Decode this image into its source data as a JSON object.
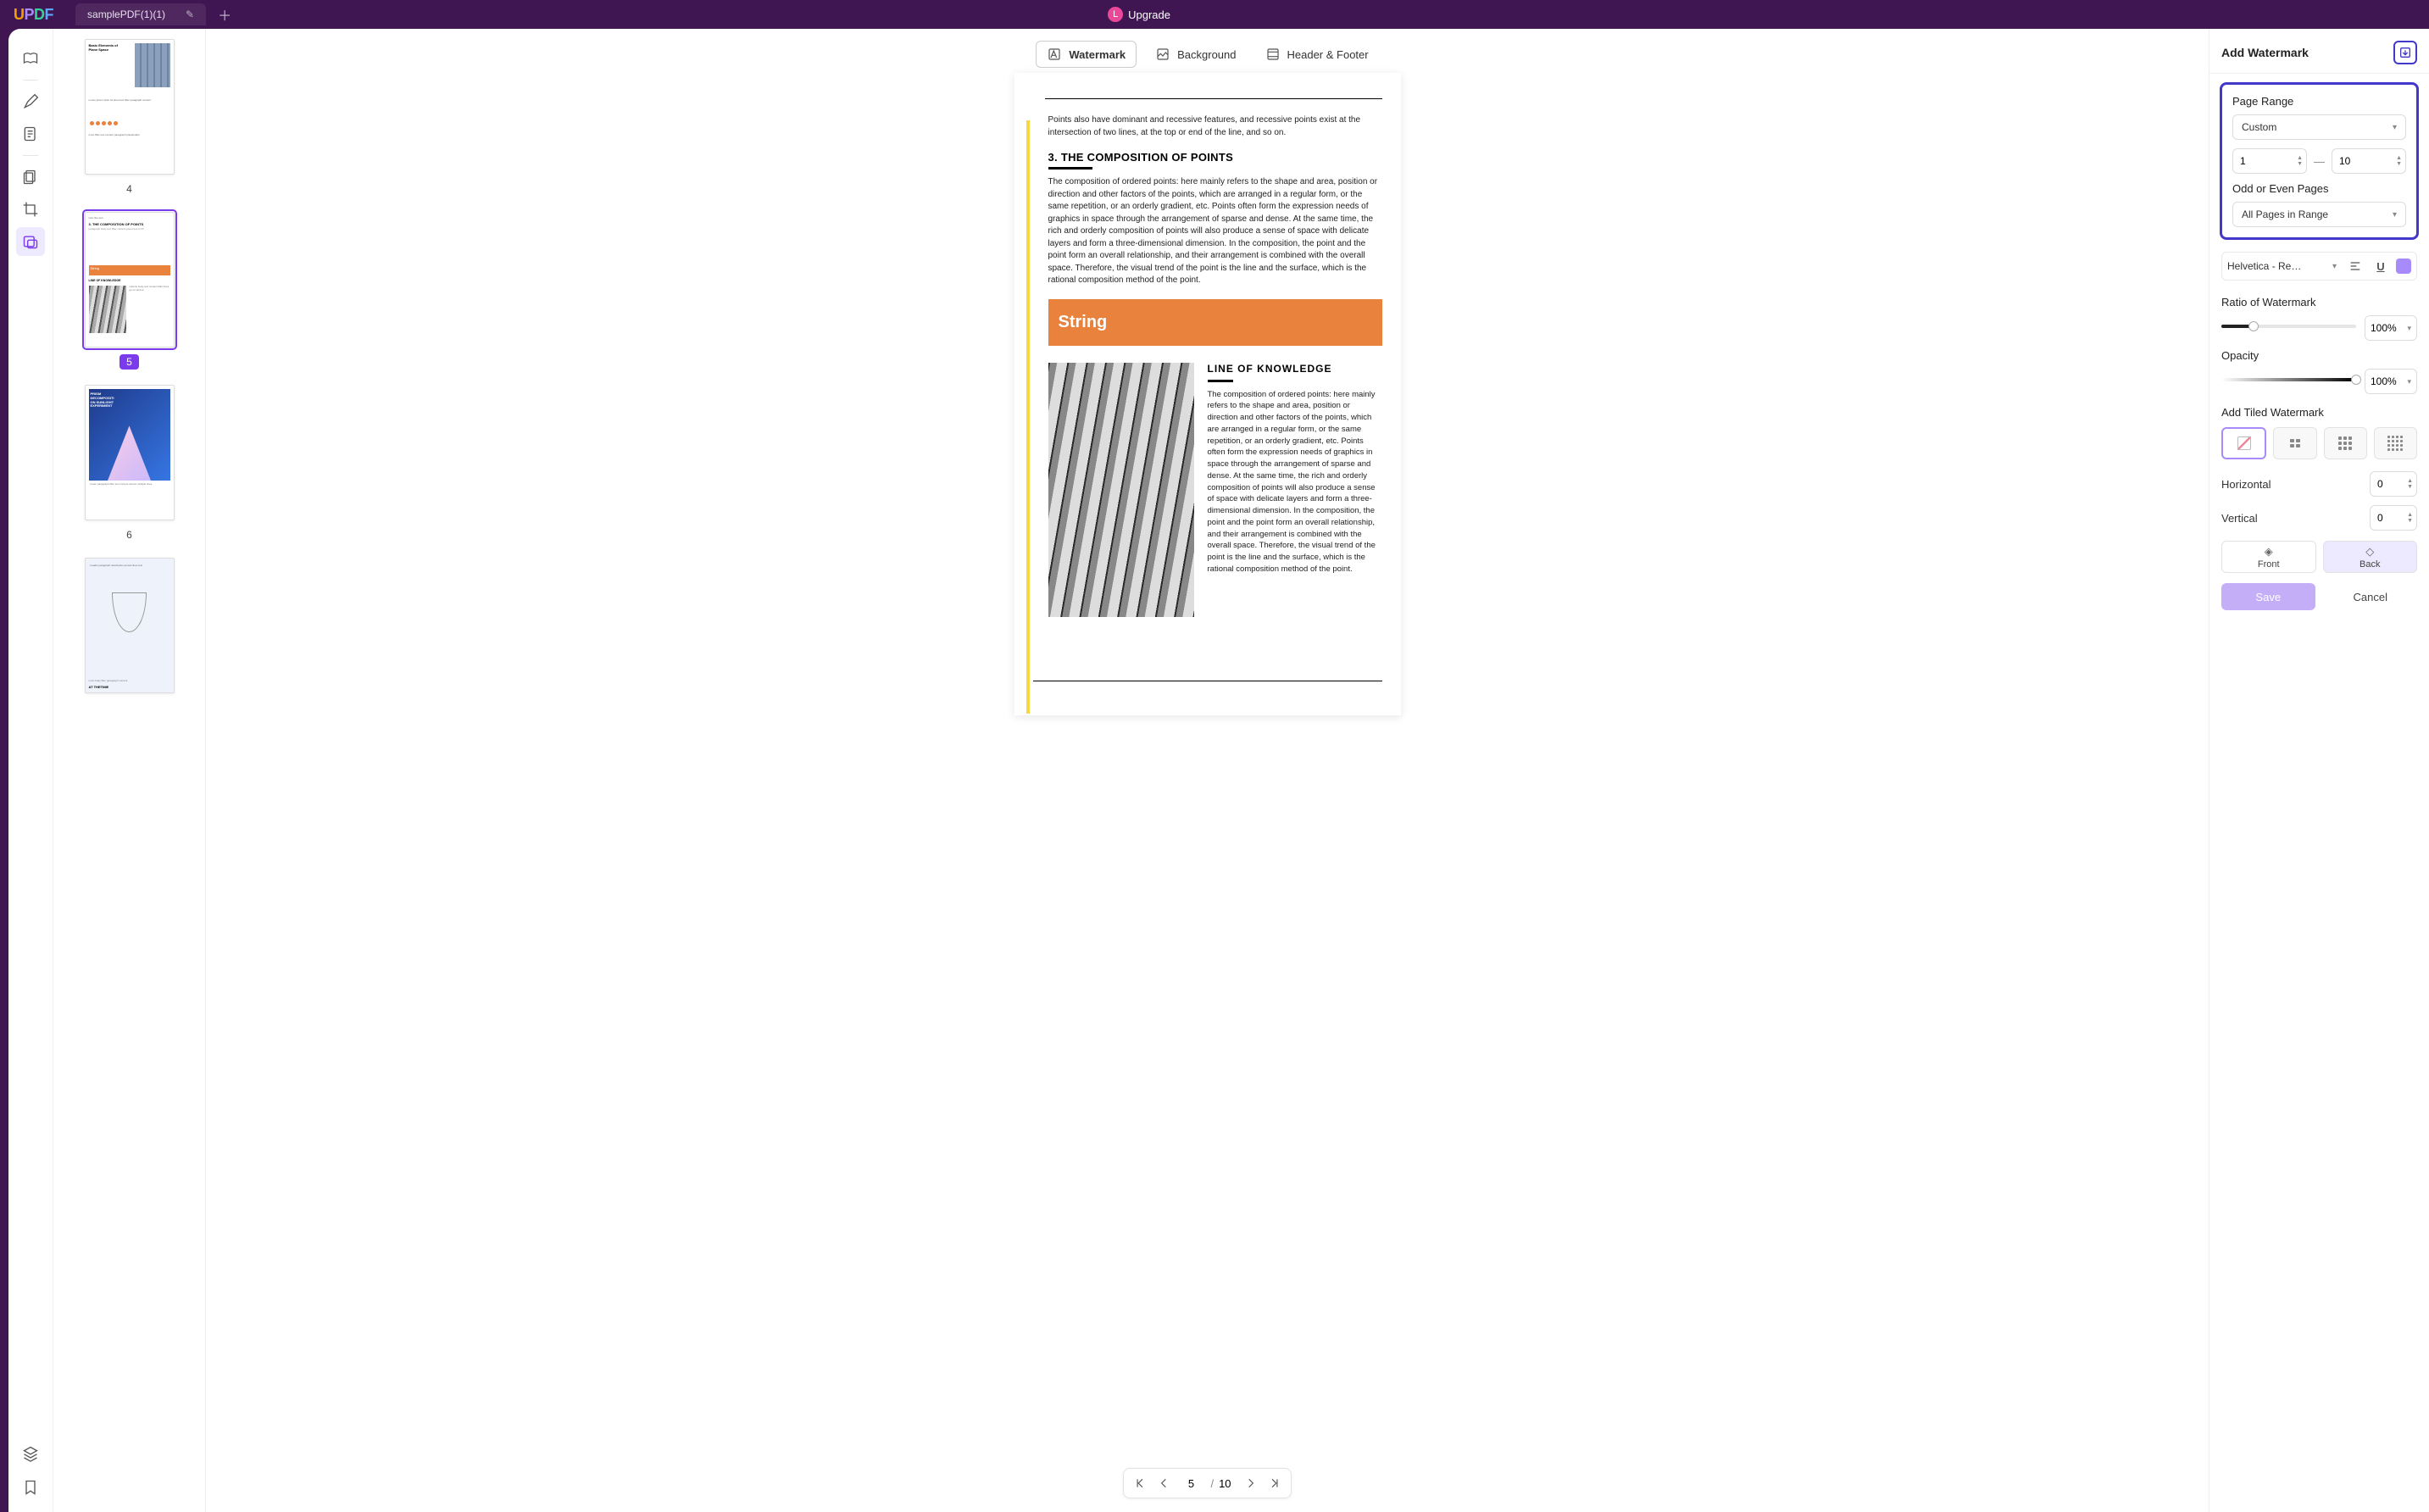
{
  "titlebar": {
    "tab_name": "samplePDF(1)(1)",
    "upgrade": "Upgrade",
    "avatar_letter": "L"
  },
  "top_tabs": {
    "watermark": "Watermark",
    "background": "Background",
    "header_footer": "Header & Footer"
  },
  "thumbnails": {
    "p4": "4",
    "p5": "5",
    "p6": "6"
  },
  "page": {
    "intro": "Points also have dominant and recessive features, and recessive points exist at the intersection of two lines, at the top or end of the line, and so on.",
    "h3": "3. THE COMPOSITION OF POINTS",
    "body": "The composition of ordered points: here mainly refers to the shape and area, position or direction and other factors of the points, which are arranged in a regular form, or the same repetition, or an orderly gradient, etc. Points often form the expression needs of graphics in space through the arrangement of sparse and dense. At the same time, the rich and orderly composition of points will also produce a sense of space with delicate layers and form a three-dimensional dimension. In the composition, the point and the point form an overall relationship, and their arrangement is combined with the overall space. Therefore, the visual trend of the point is the line and the surface, which is the rational composition method of the point.",
    "orange": "String",
    "h4": "LINE OF KNOWLEDGE",
    "col_body": "The composition of ordered points: here mainly refers to the shape and area, position or direction and other factors of the points, which are arranged in a regular form, or the same repetition, or an orderly gradient, etc. Points often form the expression needs of graphics in space through the arrangement of sparse and dense. At the same time, the rich and orderly composition of points will also produce a sense of space with delicate layers and form a three- dimensional dimension. In the composition, the point and the point form an overall relationship, and their arrangement is combined with the overall space. Therefore, the visual trend of the point is the line and the surface, which is the rational composition method of the point."
  },
  "pager": {
    "current": "5",
    "total": "10"
  },
  "right": {
    "title": "Add Watermark",
    "page_range_label": "Page Range",
    "page_range_mode": "Custom",
    "range_from": "1",
    "range_to": "10",
    "odd_even_label": "Odd or Even Pages",
    "odd_even_value": "All Pages in Range",
    "font": "Helvetica - Re…",
    "ratio_label": "Ratio of Watermark",
    "ratio_value": "100%",
    "opacity_label": "Opacity",
    "opacity_value": "100%",
    "tiled_label": "Add Tiled Watermark",
    "horizontal_label": "Horizontal",
    "horizontal_value": "0",
    "vertical_label": "Vertical",
    "vertical_value": "0",
    "front": "Front",
    "back": "Back",
    "save": "Save",
    "cancel": "Cancel"
  }
}
